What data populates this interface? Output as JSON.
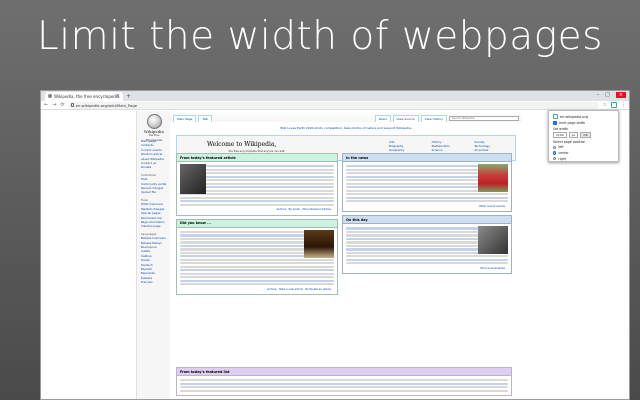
{
  "headline": "Limit the width of webpages",
  "browser": {
    "tab_title": "Wikipedia, the free encyclopedia",
    "tab_close": "×",
    "new_tab": "+",
    "window_controls": {
      "minimize": "–",
      "maximize": "□",
      "close": "×"
    },
    "nav": {
      "back": "←",
      "forward": "→",
      "reload": "⟳"
    },
    "address": "en.wikipedia.org/wiki/Main_Page",
    "star": "☆",
    "menu": "⋮"
  },
  "wiki": {
    "logo_name": "Wikipedia",
    "logo_sub": "The Free Encyclopedia",
    "sidebar": {
      "nav": [
        "Main page",
        "Contents",
        "Current events",
        "Random article",
        "About Wikipedia",
        "Contact us",
        "Donate"
      ],
      "contribute_label": "Contribute",
      "contribute": [
        "Help",
        "Community portal",
        "Recent changes",
        "Upload file"
      ],
      "tools_label": "Tools",
      "tools": [
        "What links here",
        "Related changes",
        "Special pages",
        "Permanent link",
        "Page information",
        "Cite this page"
      ],
      "languages_label": "Languages",
      "languages": [
        "Bahasa Indonesia",
        "Bahasa Melayu",
        "Български",
        "Català",
        "Čeština",
        "Dansk",
        "Deutsch",
        "Español",
        "Esperanto",
        "Euskara",
        "Français"
      ]
    },
    "tabs": {
      "main": "Main Page",
      "talk": "Talk",
      "read": "Read",
      "view_source": "View source",
      "view_history": "View history"
    },
    "search_placeholder": "Search Wikipedia",
    "banner": "Wiki Loves Earth 2020 photo competition: take photos of nature and support Wikipedia.",
    "welcome_title": "Welcome to Wikipedia,",
    "welcome_sub": "the free encyclopedia that anyone can edit.",
    "welcome_count": "6,110,853 articles in English",
    "portals": [
      "Arts",
      "Biography",
      "Geography",
      "History",
      "Mathematics",
      "Science",
      "Society",
      "Technology",
      "All portals"
    ],
    "tfa_heading": "From today's featured article",
    "dyk_heading": "Did you know ...",
    "itn_heading": "In the news",
    "otd_heading": "On this day",
    "tfp_heading": "From today's featured list",
    "itn_more": "Other recent events",
    "otd_more": "More anniversaries",
    "tfa_more": "Archive · By email · More featured articles",
    "dyk_more": "Archive · Start a new article · Nominate an article"
  },
  "popup": {
    "site": "en.wikipedia.org",
    "limit_width_label": "Limit page width",
    "set_width_label": "Set width",
    "width_value": "1100",
    "width_unit": "px",
    "apply_label": "OK",
    "alignment_label": "Select page position",
    "alignments": [
      "left",
      "center",
      "right"
    ],
    "selected_alignment": "center",
    "accent_color": "#1a73e8"
  }
}
